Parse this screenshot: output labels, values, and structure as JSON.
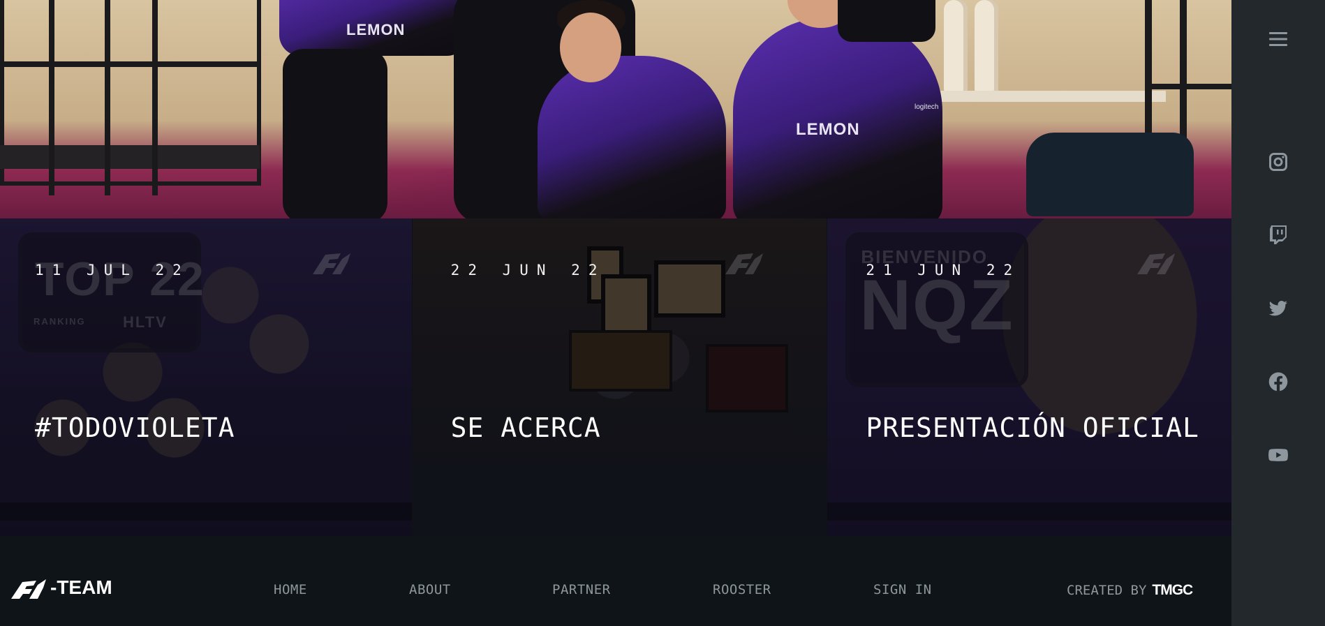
{
  "hero": {
    "jersey_text_1": "LEMON",
    "jersey_text_2": "LEMON",
    "jersey_sponsor": "logitech"
  },
  "news": [
    {
      "date": "11 JUL 22",
      "title": "#TODOVIOLETA",
      "image_text_1": "TOP 22",
      "image_text_2": "HLTV",
      "image_text_3": "RANKING"
    },
    {
      "date": "22 JUN 22",
      "title": "SE ACERCA"
    },
    {
      "date": "21 JUN 22",
      "title": "PRESENTACIÓN OFICIAL",
      "image_text_1": "BIENVENIDO",
      "image_text_2": "NQZ"
    }
  ],
  "footer": {
    "brand": "-TEAM",
    "nav": {
      "home": "HOME",
      "about": "ABOUT",
      "partner": "PARTNER",
      "rooster": "ROOSTER",
      "sign_in": "SIGN IN"
    },
    "credit_label": "CREATED BY",
    "credit_brand": "TMGC"
  },
  "sidebar": {
    "icons": [
      "menu-icon",
      "instagram-icon",
      "twitch-icon",
      "twitter-icon",
      "facebook-icon",
      "youtube-icon"
    ]
  },
  "colors": {
    "accent_purple": "#5b2fb0",
    "footer_bg": "#0e1417",
    "sidebar_bg": "#22282c",
    "nav_text": "#8e979c"
  }
}
